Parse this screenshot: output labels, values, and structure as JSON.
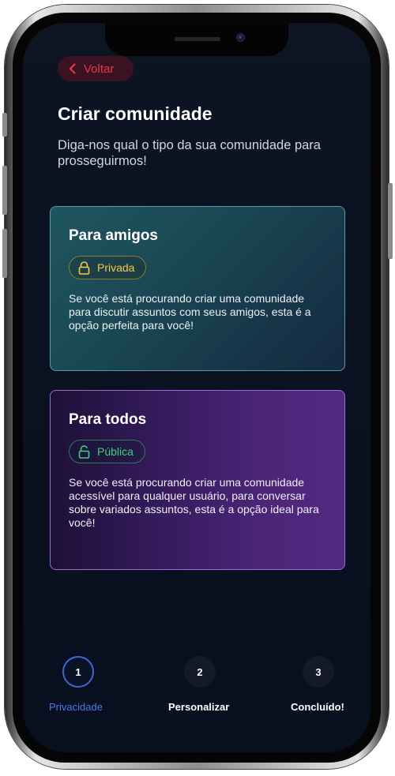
{
  "header": {
    "back_label": "Voltar",
    "title": "Criar comunidade",
    "subtitle": "Diga-nos qual o tipo da sua comunidade para prosseguirmos!"
  },
  "options": [
    {
      "title": "Para amigos",
      "badge": "Privada",
      "badge_icon": "lock-icon",
      "badge_color": "#f2c94c",
      "description": "Se você está procurando criar uma comunidade para discutir assuntos com seus amigos, esta é a opção perfeita para você!"
    },
    {
      "title": "Para todos",
      "badge": "Pública",
      "badge_icon": "unlock-icon",
      "badge_color": "#3ccf84",
      "description": "Se você está procurando criar uma comunidade acessível para qualquer usuário, para conversar sobre variados assuntos, esta é a opção ideal para você!"
    }
  ],
  "steps": [
    {
      "number": "1",
      "label": "Privacidade",
      "active": true
    },
    {
      "number": "2",
      "label": "Personalizar",
      "active": false
    },
    {
      "number": "3",
      "label": "Concluído!",
      "active": false
    }
  ],
  "colors": {
    "accent": "#3f66d8",
    "danger": "#e8354e",
    "background": "#0a1120"
  }
}
